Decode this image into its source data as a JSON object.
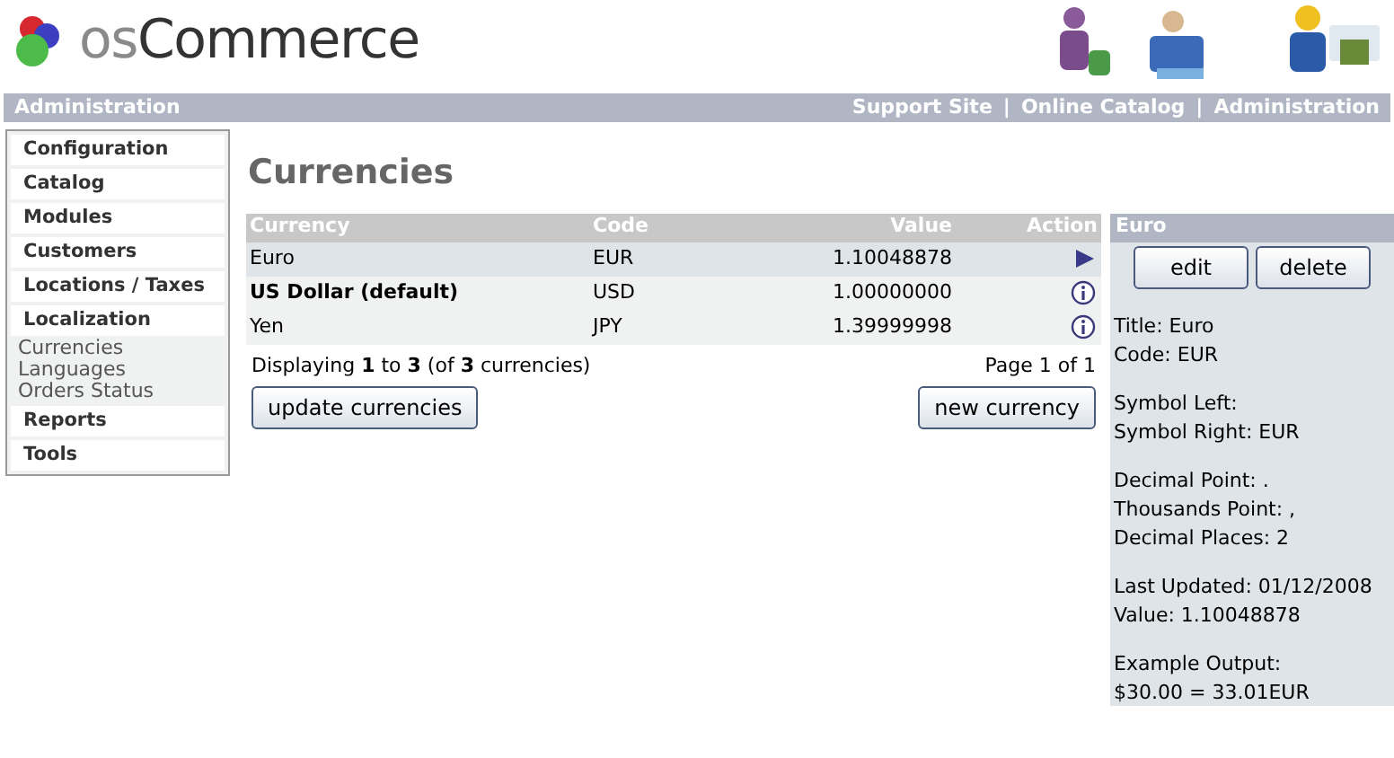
{
  "logo": {
    "prefix": "os",
    "name": "Commerce"
  },
  "header_bar": {
    "title": "Administration",
    "links": [
      "Support Site",
      "Online Catalog",
      "Administration"
    ],
    "separator": "|"
  },
  "sidebar": {
    "items": [
      {
        "label": "Configuration"
      },
      {
        "label": "Catalog"
      },
      {
        "label": "Modules"
      },
      {
        "label": "Customers"
      },
      {
        "label": "Locations / Taxes"
      },
      {
        "label": "Localization",
        "children": [
          {
            "label": "Currencies"
          },
          {
            "label": "Languages"
          },
          {
            "label": "Orders Status"
          }
        ]
      },
      {
        "label": "Reports"
      },
      {
        "label": "Tools"
      }
    ]
  },
  "page_title": "Currencies",
  "table": {
    "columns": [
      "Currency",
      "Code",
      "Value",
      "Action"
    ],
    "rows": [
      {
        "currency": "Euro",
        "code": "EUR",
        "value": "1.10048878",
        "selected": true,
        "default": false
      },
      {
        "currency": "US Dollar (default)",
        "code": "USD",
        "value": "1.00000000",
        "selected": false,
        "default": true
      },
      {
        "currency": "Yen",
        "code": "JPY",
        "value": "1.39999998",
        "selected": false,
        "default": false
      }
    ]
  },
  "pagination": {
    "summary": "Displaying **1** to **3** (of **3** currencies)",
    "page": "Page 1 of 1"
  },
  "buttons": {
    "update": "update currencies",
    "new": "new currency"
  },
  "info_panel": {
    "title": "Euro",
    "buttons": [
      "edit",
      "delete"
    ],
    "groups": [
      [
        "Title: Euro",
        "Code: EUR"
      ],
      [
        "Symbol Left:",
        "Symbol Right: EUR"
      ],
      [
        "Decimal Point: .",
        "Thousands Point: ,",
        "Decimal Places: 2"
      ],
      [
        "Last Updated: 01/12/2008",
        "Value: 1.10048878"
      ],
      [
        "Example Output:",
        "$30.00 = 33.01EUR"
      ]
    ]
  }
}
